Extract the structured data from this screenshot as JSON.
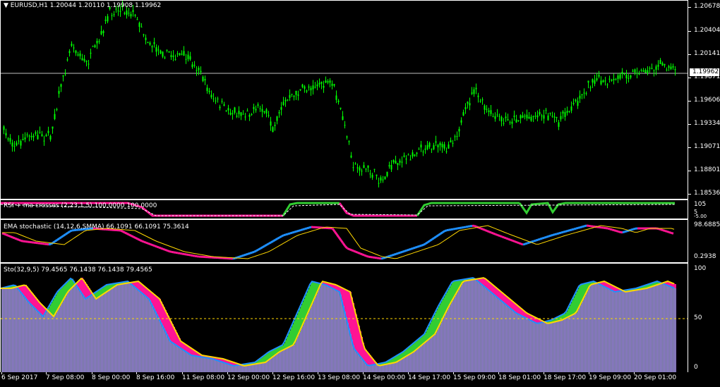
{
  "main": {
    "symbol_menu": "▼",
    "header": "EURUSD,H1  1.20044 1.20110 1.19908 1.19962",
    "price_levels": [
      "1.20678",
      "1.20404",
      "1.20141",
      "1.19871",
      "1.19606",
      "1.19334",
      "1.19071",
      "1.18801",
      "1.18536"
    ],
    "current_price": "1.19962",
    "candle_color": "#00ff00"
  },
  "rsi": {
    "header": "RSI + ma crosses (2,23,1,5) 100.0000 100.0000",
    "levels": [
      "105",
      "5",
      "-5.00"
    ],
    "line_colors": {
      "up": "#32cd32",
      "down": "#ff1493",
      "signal": "#ffffff"
    }
  },
  "ema_stoch": {
    "header": "EMA stochastic (14,12,6,SMMA) 66.1091 66.1091 75.3614",
    "levels": [
      "98.6885",
      "0.2938"
    ],
    "line_colors": {
      "up": "#1e90ff",
      "down": "#ff1493",
      "signal": "#ffd700"
    }
  },
  "sto": {
    "header": "Sto(32,9,5) 79.4565 76.1438 76.1438 79.4565",
    "levels": [
      "100",
      "50",
      "0"
    ],
    "colors": {
      "histogram": "#708090",
      "fill_up": "#32cd32",
      "fill_down": "#ff1493",
      "main": "#1e90ff",
      "signal": "#ffd700",
      "level": "#ffd700"
    }
  },
  "time_axis": {
    "labels": [
      "6 Sep 2017",
      "7 Sep 08:00",
      "8 Sep 00:00",
      "8 Sep 16:00",
      "11 Sep 08:00",
      "12 Sep 00:00",
      "12 Sep 16:00",
      "13 Sep 08:00",
      "14 Sep 00:00",
      "14 Sep 17:00",
      "15 Sep 09:00",
      "18 Sep 01:00",
      "18 Sep 17:00",
      "19 Sep 09:00",
      "20 Sep 01:00"
    ]
  }
}
